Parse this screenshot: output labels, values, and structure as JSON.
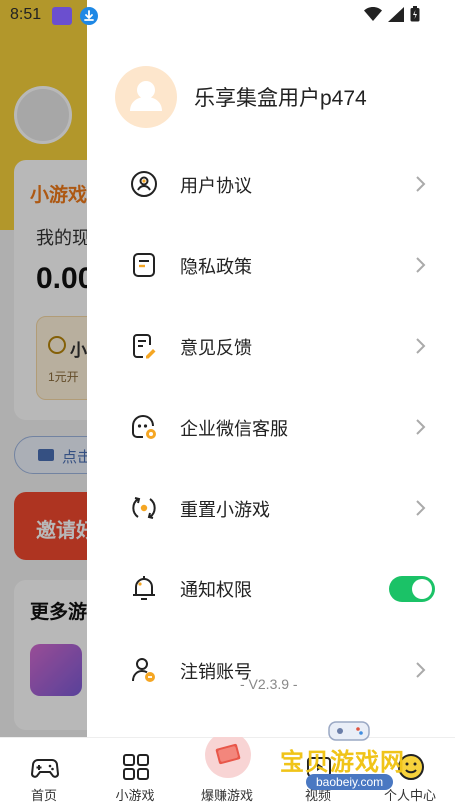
{
  "status_bar": {
    "time": "8:51"
  },
  "background": {
    "card_title": "小游戏",
    "card_sub": "我的现",
    "card_amount": "0.00",
    "box_title": "小",
    "box_sub": "1元开",
    "pill_text": "点击",
    "banner_text": "邀请好",
    "more_title": "更多游"
  },
  "drawer": {
    "username": "乐享集盒用户p474",
    "menu": [
      {
        "label": "用户协议",
        "icon": "user-agreement-icon",
        "control": "arrow"
      },
      {
        "label": "隐私政策",
        "icon": "privacy-policy-icon",
        "control": "arrow"
      },
      {
        "label": "意见反馈",
        "icon": "feedback-icon",
        "control": "arrow"
      },
      {
        "label": "企业微信客服",
        "icon": "wechat-service-icon",
        "control": "arrow"
      },
      {
        "label": "重置小游戏",
        "icon": "reset-game-icon",
        "control": "arrow"
      },
      {
        "label": "通知权限",
        "icon": "bell-icon",
        "control": "toggle",
        "enabled": true
      },
      {
        "label": "注销账号",
        "icon": "cancel-account-icon",
        "control": "arrow"
      }
    ],
    "version": "- V2.3.9 -"
  },
  "bottom_nav": [
    {
      "label": "首页",
      "icon": "gamepad-icon"
    },
    {
      "label": "小游戏",
      "icon": "grid-icon"
    },
    {
      "label": "爆赚游戏",
      "icon": "money-icon"
    },
    {
      "label": "视频",
      "icon": "video-icon"
    },
    {
      "label": "个人中心",
      "icon": "smile-icon"
    }
  ],
  "watermark": {
    "title": "宝贝游戏网",
    "url": "baobeiy.com"
  },
  "colors": {
    "accent_yellow": "#f7d23c",
    "toggle_green": "#1bc267",
    "icon_orange": "#f5a623"
  }
}
